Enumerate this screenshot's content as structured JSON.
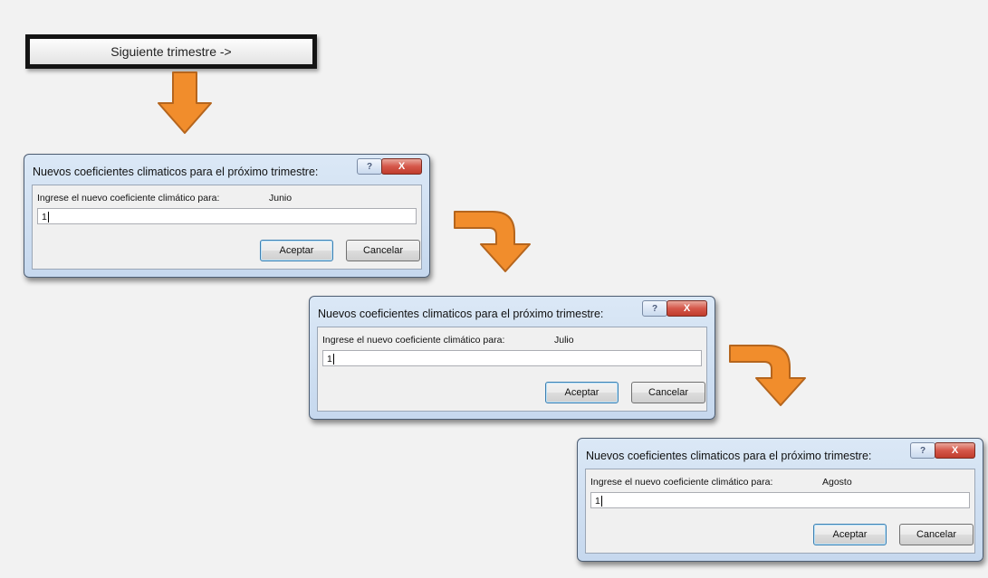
{
  "next_button": {
    "label": "Siguiente trimestre ->"
  },
  "dialogs": [
    {
      "title": "Nuevos coeficientes climaticos para el próximo trimestre:",
      "help_label": "?",
      "close_label": "X",
      "prompt": "Ingrese el nuevo coeficiente climático para:",
      "month": "Junio",
      "input_value": "1",
      "ok_label": "Aceptar",
      "cancel_label": "Cancelar"
    },
    {
      "title": "Nuevos coeficientes climaticos para el próximo trimestre:",
      "help_label": "?",
      "close_label": "X",
      "prompt": "Ingrese el nuevo coeficiente climático para:",
      "month": "Julio",
      "input_value": "1",
      "ok_label": "Aceptar",
      "cancel_label": "Cancelar"
    },
    {
      "title": "Nuevos coeficientes climaticos para el próximo trimestre:",
      "help_label": "?",
      "close_label": "X",
      "prompt": "Ingrese el nuevo coeficiente climático para:",
      "month": "Agosto",
      "input_value": "1",
      "ok_label": "Aceptar",
      "cancel_label": "Cancelar"
    }
  ],
  "colors": {
    "arrow_fill": "#f18d2c",
    "arrow_stroke": "#b5651d",
    "close_button": "#c9473a",
    "title_gradient_top": "#dbe8f6"
  }
}
